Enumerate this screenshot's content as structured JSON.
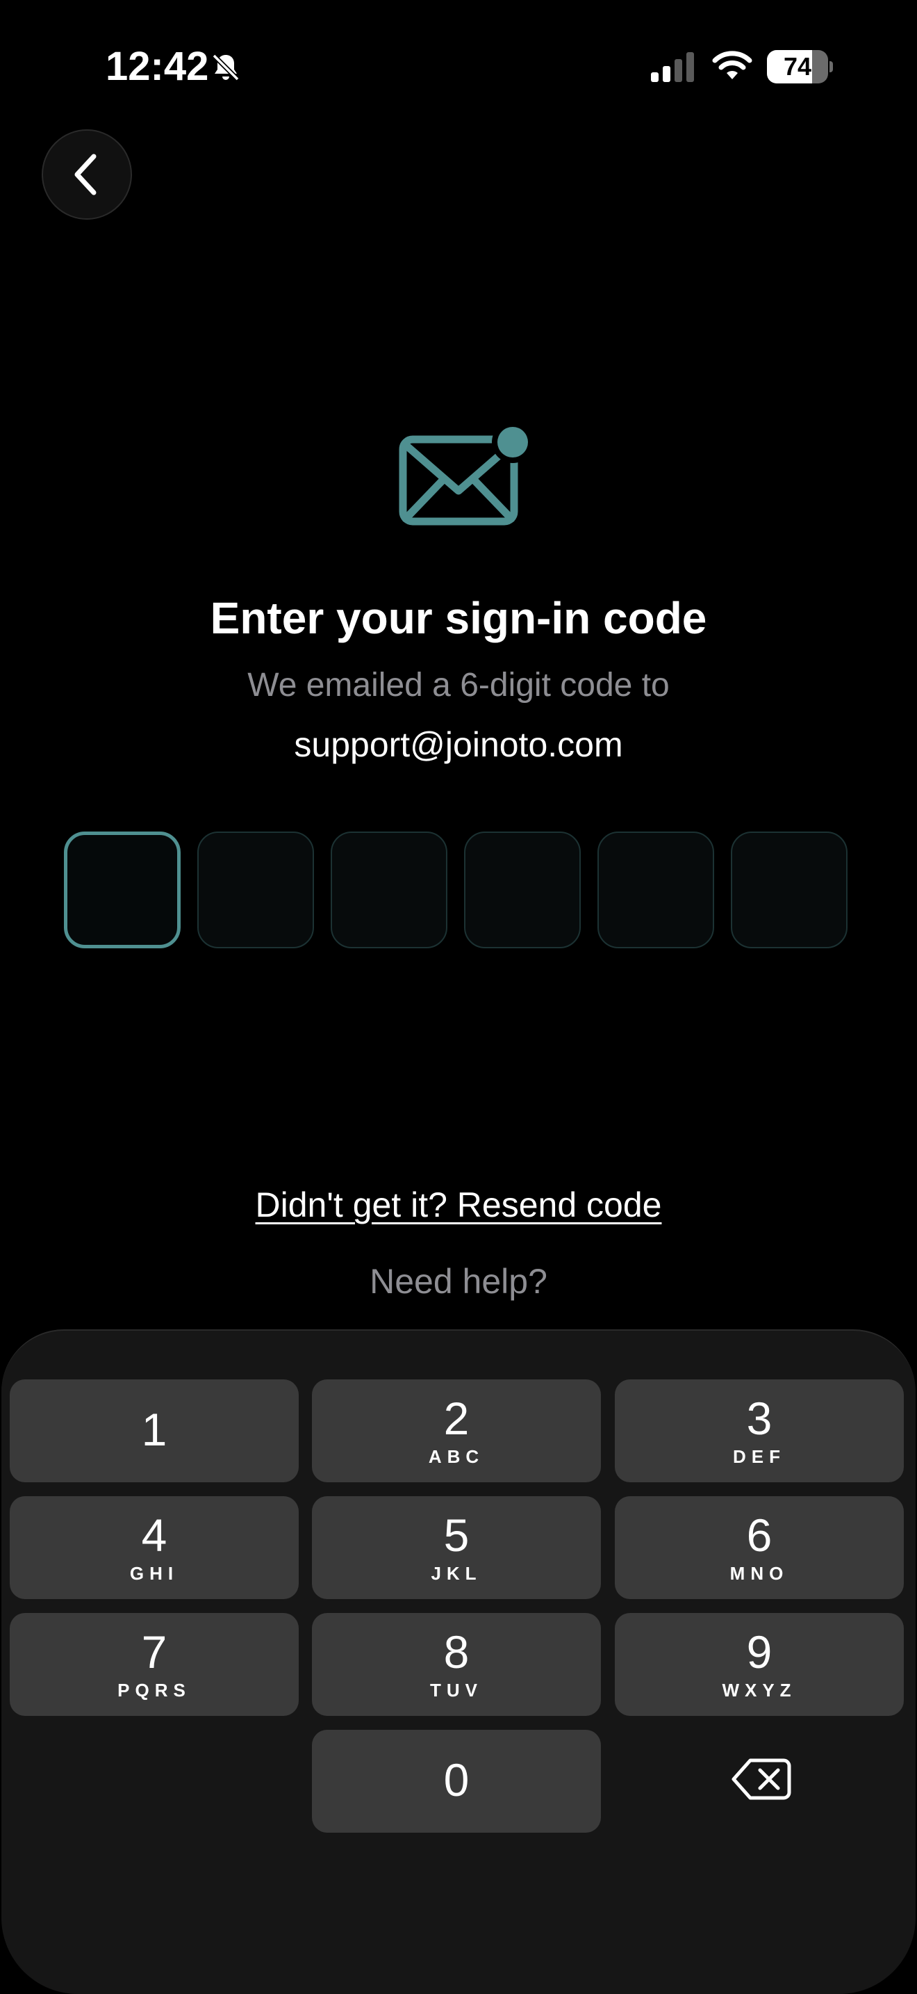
{
  "status_bar": {
    "time": "12:42",
    "battery_level": "74",
    "battery_fraction": 0.74,
    "icons": [
      "bell-slash-icon",
      "cellular-signal-icon",
      "wifi-icon",
      "battery-icon"
    ]
  },
  "nav": {
    "back_icon": "chevron-left-icon"
  },
  "header": {
    "icon": "mail-notification-icon",
    "title": "Enter your sign-in code",
    "subtitle": "We emailed a 6-digit code to",
    "email": "support@joinoto.com"
  },
  "code": {
    "length": 6,
    "values": [
      "",
      "",
      "",
      "",
      "",
      ""
    ],
    "active_index": 0
  },
  "links": {
    "resend": "Didn't get it? Resend code",
    "help": "Need help?"
  },
  "keypad": {
    "keys": [
      {
        "digit": "1",
        "letters": ""
      },
      {
        "digit": "2",
        "letters": "ABC"
      },
      {
        "digit": "3",
        "letters": "DEF"
      },
      {
        "digit": "4",
        "letters": "GHI"
      },
      {
        "digit": "5",
        "letters": "JKL"
      },
      {
        "digit": "6",
        "letters": "MNO"
      },
      {
        "digit": "7",
        "letters": "PQRS"
      },
      {
        "digit": "8",
        "letters": "TUV"
      },
      {
        "digit": "9",
        "letters": "WXYZ"
      },
      {
        "digit": "0",
        "letters": ""
      }
    ],
    "delete_icon": "backspace-icon"
  },
  "colors": {
    "background": "#000000",
    "accent": "#4f9091",
    "muted_text": "#8e8e93",
    "keypad_bg": "#161616",
    "key_bg": "#3a3a3a"
  }
}
